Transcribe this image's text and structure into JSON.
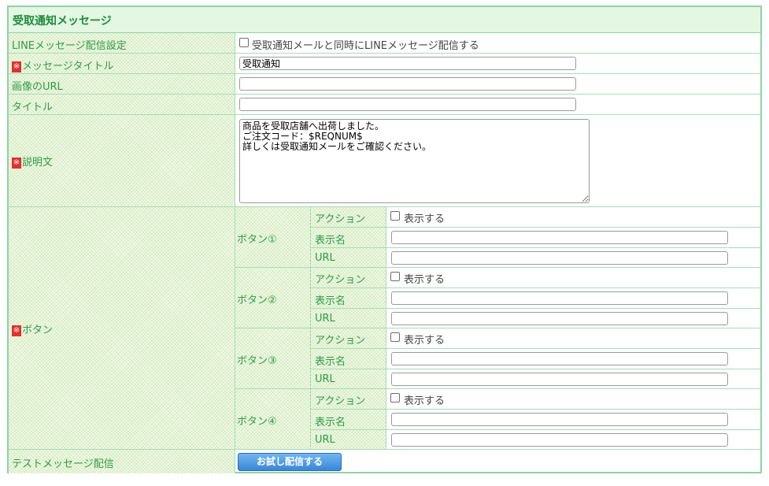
{
  "section": {
    "title": "受取通知メッセージ"
  },
  "rows": {
    "line_setting": {
      "label": "LINEメッセージ配信設定",
      "checkbox_label": "受取通知メールと同時にLINEメッセージ配信する"
    },
    "message_title": {
      "required_mark": "※",
      "label": "メッセージタイトル",
      "value": "受取通知"
    },
    "image_url": {
      "label": "画像のURL",
      "value": ""
    },
    "title": {
      "label": "タイトル",
      "value": ""
    },
    "description": {
      "required_mark": "※",
      "label": "説明文",
      "value": "商品を受取店舗へ出荷しました。\nご注文コード：$REQNUM$\n詳しくは受取通知メールをご確認ください。"
    },
    "buttons": {
      "required_mark": "※",
      "label": "ボタン",
      "items": [
        {
          "name": "ボタン①",
          "action_label": "アクション",
          "show_label": "表示する",
          "display_name_label": "表示名",
          "url_label": "URL"
        },
        {
          "name": "ボタン②",
          "action_label": "アクション",
          "show_label": "表示する",
          "display_name_label": "表示名",
          "url_label": "URL"
        },
        {
          "name": "ボタン③",
          "action_label": "アクション",
          "show_label": "表示する",
          "display_name_label": "表示名",
          "url_label": "URL"
        },
        {
          "name": "ボタン④",
          "action_label": "アクション",
          "show_label": "表示する",
          "display_name_label": "表示名",
          "url_label": "URL"
        }
      ]
    },
    "test": {
      "label": "テストメッセージ配信",
      "button_label": "お試し配信する"
    }
  }
}
